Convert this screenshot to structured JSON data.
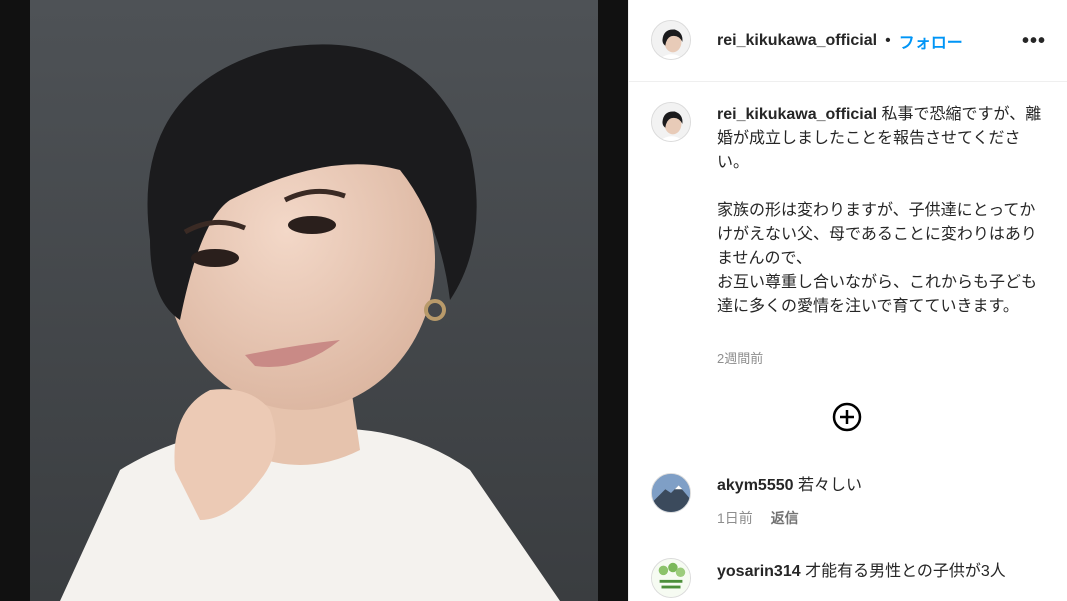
{
  "post": {
    "username": "rei_kikukawa_official",
    "follow_label": "フォロー",
    "separator": "•",
    "more_label": "•••",
    "caption": "私事で恐縮ですが、離婚が成立しましたことを報告させてください。\n\n家族の形は変わりますが、子供達にとってかけがえない父、母であることに変わりはありませんので、\nお互い尊重し合いながら、これからも子ども達に多くの愛情を注いで育てていきます。",
    "time_ago": "2週間前"
  },
  "comments": [
    {
      "username": "akym5550",
      "text": "若々しい",
      "time_ago": "1日前",
      "reply_label": "返信"
    },
    {
      "username": "yosarin314",
      "text": "才能有る男性との子供が3人"
    }
  ],
  "colors": {
    "accent": "#0095f6",
    "muted": "#8e8e8e",
    "text": "#262626"
  },
  "icons": {
    "add": "plus-circle-icon",
    "more": "more-options-icon"
  }
}
